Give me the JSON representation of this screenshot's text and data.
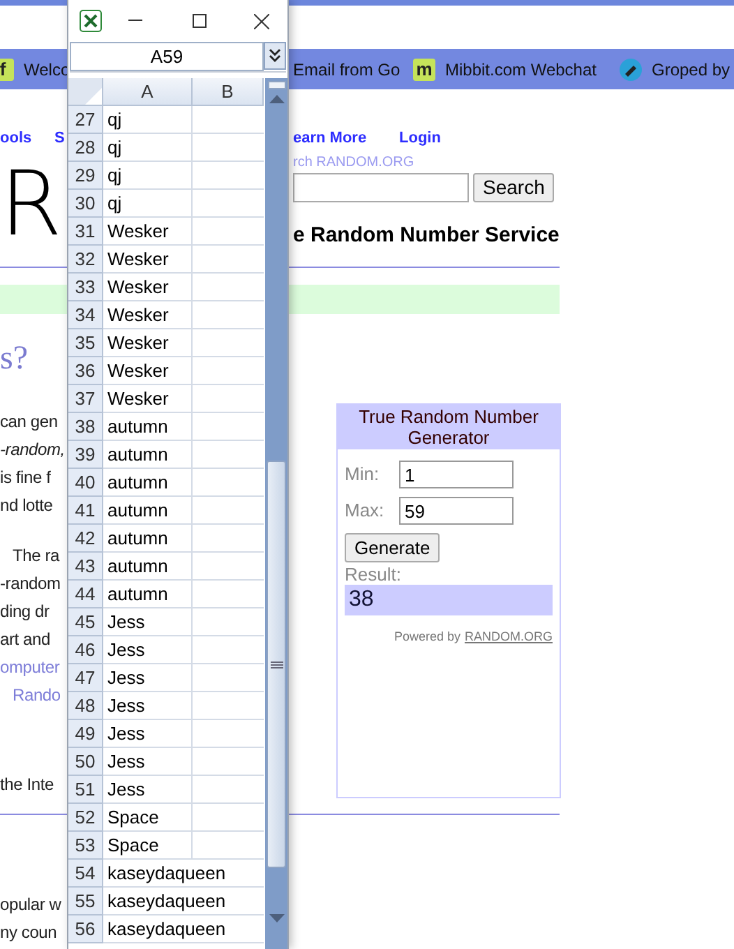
{
  "browser": {
    "bookmarks": [
      {
        "kind": "letter",
        "icon_text": "f",
        "label": "Welco"
      },
      {
        "kind": "plain",
        "label": "Email from Go"
      },
      {
        "kind": "letter",
        "icon_text": "m",
        "label": "Mibbit.com Webchat"
      },
      {
        "kind": "pen",
        "label": "Groped by"
      }
    ]
  },
  "page": {
    "nav_links": [
      "ools",
      "S",
      "earn More",
      "Login"
    ],
    "logo": "R",
    "search": {
      "caption": "rch RANDOM.ORG",
      "button": "Search"
    },
    "tagline": "e Random Number Service",
    "heading": "s?",
    "paragraphs": [
      [
        {
          "kind": "text",
          "text": "can gen"
        },
        {
          "kind": "italic",
          "text": "-random,"
        },
        {
          "kind": "text",
          "text": "is fine f"
        },
        {
          "kind": "text",
          "text": "nd lotte"
        }
      ],
      [
        {
          "kind": "text",
          "text": "The ra",
          "indented": true
        },
        {
          "kind": "text",
          "text": "-random"
        },
        {
          "kind": "text",
          "text": "ding dr"
        },
        {
          "kind": "text",
          "text": "art and"
        },
        {
          "kind": "link",
          "text": "omputer"
        },
        {
          "kind": "link",
          "text": "Rando",
          "indented": true
        }
      ],
      [
        {
          "kind": "text",
          "text": "the Inte"
        }
      ],
      [
        {
          "kind": "text",
          "text": "opular w"
        },
        {
          "kind": "text",
          "text": "ny coun"
        }
      ]
    ],
    "widget": {
      "title": "True Random Number Generator",
      "fields": [
        {
          "label": "Min:",
          "value": "1"
        },
        {
          "label": "Max:",
          "value": "59"
        }
      ],
      "button": "Generate",
      "result_label": "Result:",
      "result": "38",
      "powered_by": "Powered by",
      "powered_link": "RANDOM.ORG"
    }
  },
  "spreadsheet": {
    "name_box": "A59",
    "columns": [
      "A",
      "B"
    ],
    "rows": [
      {
        "number": "27",
        "value": "qj",
        "overflows": false
      },
      {
        "number": "28",
        "value": "qj",
        "overflows": false
      },
      {
        "number": "29",
        "value": "qj",
        "overflows": false
      },
      {
        "number": "30",
        "value": "qj",
        "overflows": false
      },
      {
        "number": "31",
        "value": "Wesker",
        "overflows": false
      },
      {
        "number": "32",
        "value": "Wesker",
        "overflows": false
      },
      {
        "number": "33",
        "value": "Wesker",
        "overflows": false
      },
      {
        "number": "34",
        "value": "Wesker",
        "overflows": false
      },
      {
        "number": "35",
        "value": "Wesker",
        "overflows": false
      },
      {
        "number": "36",
        "value": "Wesker",
        "overflows": false
      },
      {
        "number": "37",
        "value": "Wesker",
        "overflows": false
      },
      {
        "number": "38",
        "value": "autumn",
        "overflows": false
      },
      {
        "number": "39",
        "value": "autumn",
        "overflows": false
      },
      {
        "number": "40",
        "value": "autumn",
        "overflows": false
      },
      {
        "number": "41",
        "value": "autumn",
        "overflows": false
      },
      {
        "number": "42",
        "value": "autumn",
        "overflows": false
      },
      {
        "number": "43",
        "value": "autumn",
        "overflows": false
      },
      {
        "number": "44",
        "value": "autumn",
        "overflows": false
      },
      {
        "number": "45",
        "value": "Jess",
        "overflows": false
      },
      {
        "number": "46",
        "value": "Jess",
        "overflows": false
      },
      {
        "number": "47",
        "value": "Jess",
        "overflows": false
      },
      {
        "number": "48",
        "value": "Jess",
        "overflows": false
      },
      {
        "number": "49",
        "value": "Jess",
        "overflows": false
      },
      {
        "number": "50",
        "value": "Jess",
        "overflows": false
      },
      {
        "number": "51",
        "value": "Jess",
        "overflows": false
      },
      {
        "number": "52",
        "value": "Space",
        "overflows": false
      },
      {
        "number": "53",
        "value": "Space",
        "overflows": false
      },
      {
        "number": "54",
        "value": "kaseydaqueen",
        "overflows": true
      },
      {
        "number": "55",
        "value": "kaseydaqueen",
        "overflows": true
      },
      {
        "number": "56",
        "value": "kaseydaqueen",
        "overflows": true
      }
    ]
  }
}
